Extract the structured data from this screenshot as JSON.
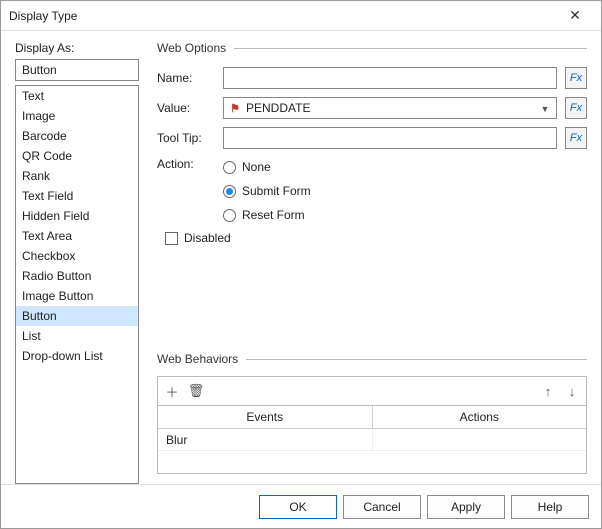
{
  "window": {
    "title": "Display Type"
  },
  "left": {
    "label": "Display As:",
    "value": "Button",
    "items": [
      "Text",
      "Image",
      "Barcode",
      "QR Code",
      "Rank",
      "Text Field",
      "Hidden Field",
      "Text Area",
      "Checkbox",
      "Radio Button",
      "Image Button",
      "Button",
      "List",
      "Drop-down List"
    ],
    "selected_index": 11
  },
  "web_options": {
    "group_title": "Web Options",
    "fields": {
      "name": {
        "label": "Name:",
        "value": "",
        "fx": "Fx"
      },
      "value": {
        "label": "Value:",
        "is_select": true,
        "selected_text": "PENDDATE",
        "fx": "Fx"
      },
      "tooltip": {
        "label": "Tool Tip:",
        "value": "",
        "fx": "Fx"
      }
    },
    "action": {
      "label": "Action:",
      "options": [
        "None",
        "Submit Form",
        "Reset Form"
      ],
      "selected_index": 1
    },
    "disabled": {
      "label": "Disabled",
      "checked": false
    }
  },
  "web_behaviors": {
    "group_title": "Web Behaviors",
    "columns": [
      "Events",
      "Actions"
    ],
    "rows": [
      {
        "event": "Blur",
        "action": ""
      }
    ]
  },
  "footer": {
    "ok": "OK",
    "cancel": "Cancel",
    "apply": "Apply",
    "help": "Help"
  }
}
